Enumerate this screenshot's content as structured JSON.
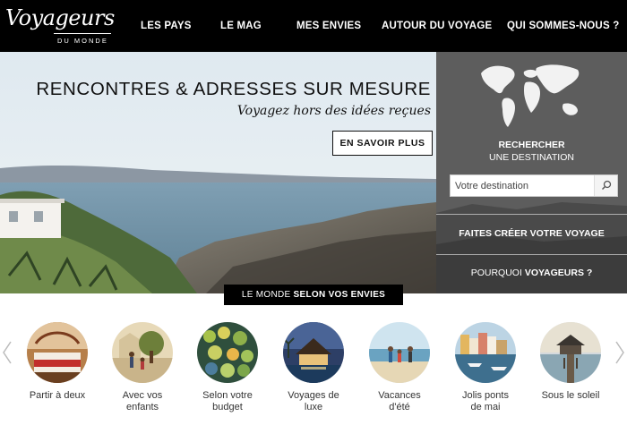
{
  "brand": {
    "name": "Voyageurs",
    "tagline": "DU MONDE"
  },
  "nav": [
    {
      "label": "LES PAYS"
    },
    {
      "label": "LE MAG"
    },
    {
      "label": "MES ENVIES"
    },
    {
      "label": "AUTOUR DU VOYAGE"
    },
    {
      "label": "QUI SOMMES-NOUS ?"
    }
  ],
  "hero": {
    "title": "RENCONTRES & ADRESSES SUR MESURE",
    "subtitle": "Voyagez hors des idées reçues",
    "cta_label": "EN SAVOIR PLUS"
  },
  "search": {
    "heading_line1": "RECHERCHER",
    "heading_line2": "UNE DESTINATION",
    "placeholder": "Votre destination"
  },
  "panel_links": {
    "create": "FAITES CRÉER VOTRE VOYAGE",
    "why_prefix": "POURQUOI ",
    "why_strong": "VOYAGEURS ?"
  },
  "section": {
    "title_prefix": "LE MONDE ",
    "title_strong": "SELON VOS ENVIES"
  },
  "categories": [
    {
      "line1": "Partir à deux",
      "line2": "",
      "icon": "romantic-bedroom-image"
    },
    {
      "line1": "Avec vos",
      "line2": "enfants",
      "icon": "family-image"
    },
    {
      "line1": "Selon votre",
      "line2": "budget",
      "icon": "market-food-image"
    },
    {
      "line1": "Voyages de",
      "line2": "luxe",
      "icon": "luxury-resort-image"
    },
    {
      "line1": "Vacances",
      "line2": "d'été",
      "icon": "beach-family-image"
    },
    {
      "line1": "Jolis ponts",
      "line2": "de mai",
      "icon": "harbor-town-image"
    },
    {
      "line1": "Sous le soleil",
      "line2": "",
      "icon": "sunset-pier-image"
    }
  ],
  "colors": {
    "topbar": "#000000",
    "panel": "#5b5b5b",
    "accent": "#000000"
  }
}
